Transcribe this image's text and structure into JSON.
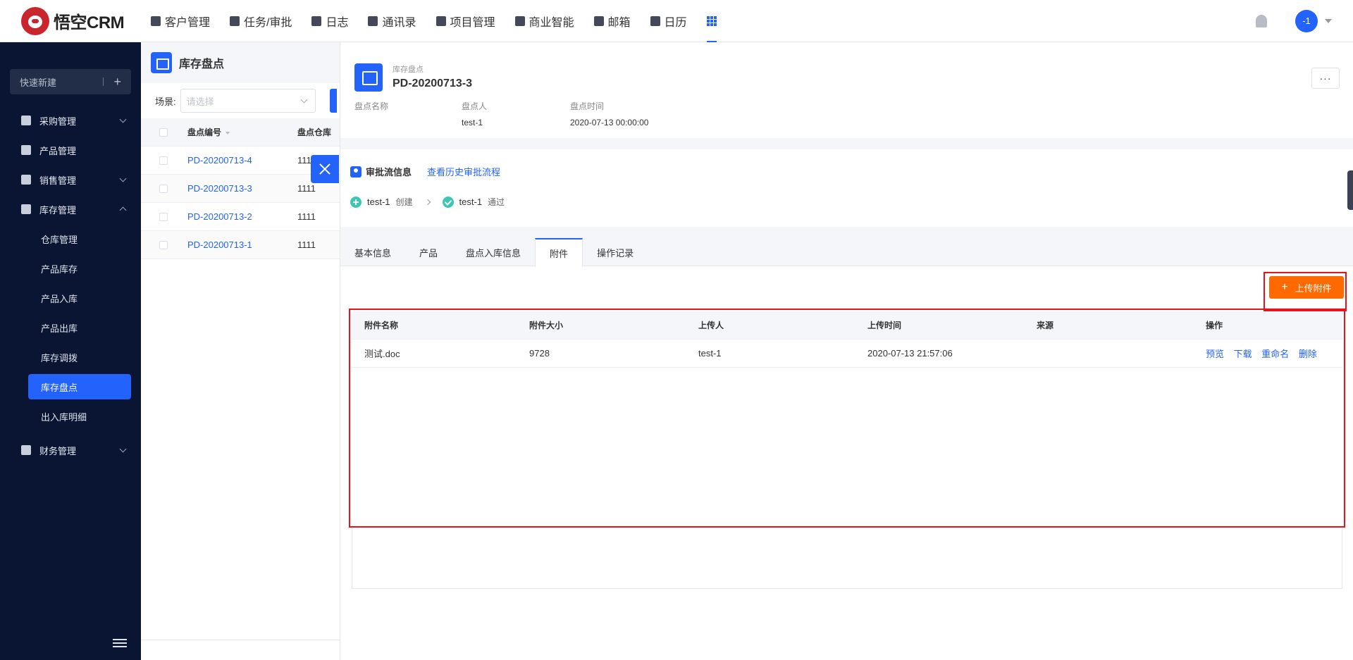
{
  "app": {
    "logo_text": "悟空CRM"
  },
  "topnav": {
    "items": [
      {
        "label": "客户管理",
        "icon": "building-icon"
      },
      {
        "label": "任务/审批",
        "icon": "briefcase-icon"
      },
      {
        "label": "日志",
        "icon": "notebook-icon"
      },
      {
        "label": "通讯录",
        "icon": "phone-book-icon"
      },
      {
        "label": "项目管理",
        "icon": "project-icon"
      },
      {
        "label": "商业智能",
        "icon": "chart-shield-icon"
      },
      {
        "label": "邮箱",
        "icon": "mail-icon"
      },
      {
        "label": "日历",
        "icon": "calendar-icon"
      }
    ],
    "avatar_text": "-1"
  },
  "sidebar": {
    "quick_new": "快速新建",
    "menu": [
      {
        "label": "采购管理",
        "icon": "cart-icon",
        "expanded": false
      },
      {
        "label": "产品管理",
        "icon": "cube-icon"
      },
      {
        "label": "销售管理",
        "icon": "tag-icon",
        "expanded": false
      },
      {
        "label": "库存管理",
        "icon": "archive-icon",
        "expanded": true
      }
    ],
    "submenu": [
      "仓库管理",
      "产品库存",
      "产品入库",
      "产品出库",
      "库存调拨",
      "库存盘点",
      "出入库明细"
    ],
    "active_submenu": "库存盘点",
    "finance": {
      "label": "财务管理",
      "icon": "wallet-icon"
    }
  },
  "list": {
    "title": "库存盘点",
    "scene_label": "场景:",
    "scene_placeholder": "请选择",
    "columns": [
      "盘点编号",
      "盘点仓库"
    ],
    "rows": [
      {
        "code": "PD-20200713-4",
        "warehouse": "1111"
      },
      {
        "code": "PD-20200713-3",
        "warehouse": "1111"
      },
      {
        "code": "PD-20200713-2",
        "warehouse": "1111"
      },
      {
        "code": "PD-20200713-1",
        "warehouse": "1111"
      }
    ]
  },
  "detail": {
    "type_label": "库存盘点",
    "title": "PD-20200713-3",
    "more": "···",
    "meta": [
      {
        "key": "盘点名称",
        "value": ""
      },
      {
        "key": "盘点人",
        "value": "test-1"
      },
      {
        "key": "盘点时间",
        "value": "2020-07-13 00:00:00"
      }
    ],
    "approval": {
      "title": "审批流信息",
      "history_link": "查看历史审批流程",
      "steps": [
        {
          "name": "test-1",
          "action": "创建"
        },
        {
          "name": "test-1",
          "action": "通过"
        }
      ]
    },
    "tabs": [
      "基本信息",
      "产品",
      "盘点入库信息",
      "附件",
      "操作记录"
    ],
    "active_tab": "附件",
    "upload_label": "上传附件",
    "attachments": {
      "columns": [
        "附件名称",
        "附件大小",
        "上传人",
        "上传时间",
        "来源",
        "操作"
      ],
      "rows": [
        {
          "name": "测试.doc",
          "size": "9728",
          "uploader": "test-1",
          "time": "2020-07-13 21:57:06",
          "source": ""
        }
      ],
      "actions": [
        "预览",
        "下载",
        "重命名",
        "删除"
      ]
    },
    "colors": {
      "primary": "#2362fb",
      "upload": "#ff6a00",
      "highlight": "#e8121c"
    }
  }
}
